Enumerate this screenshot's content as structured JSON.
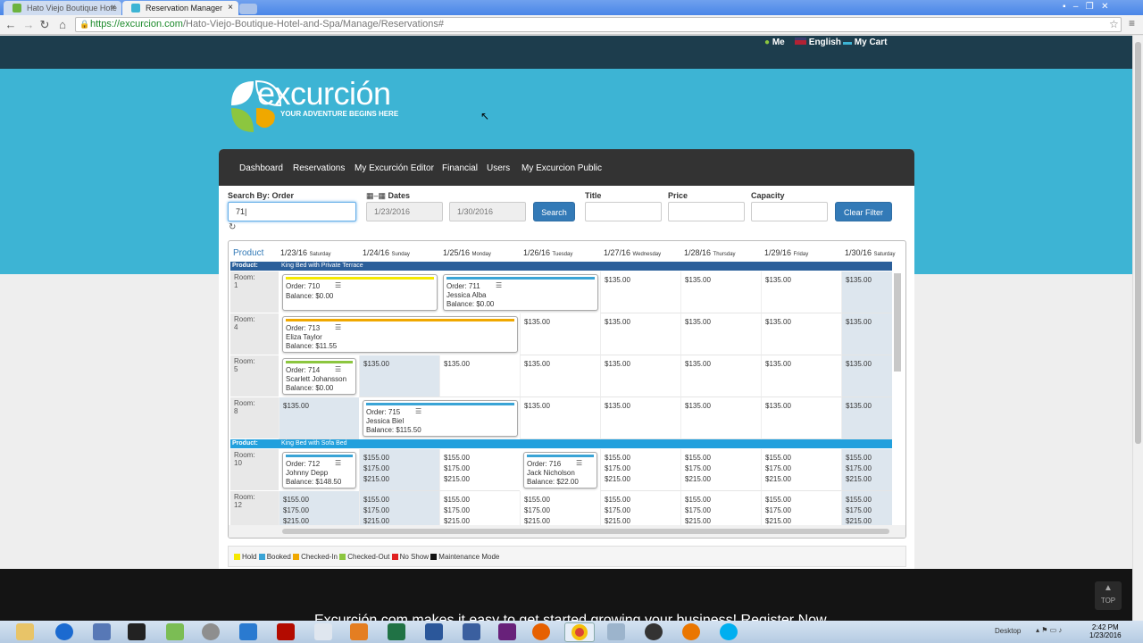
{
  "browser": {
    "tabs": [
      {
        "label": "Hato Viejo Boutique Hote"
      },
      {
        "label": "Reservation Manager"
      }
    ],
    "url_host": "https://excurcion.com",
    "url_path": "/Hato-Viejo-Boutique-Hotel-and-Spa/Manage/Reservations#"
  },
  "topnav": {
    "me": "Me",
    "language": "English",
    "cart": "My Cart"
  },
  "logo": {
    "brand": "excurción",
    "tagline": "YOUR ADVENTURE BEGINS HERE"
  },
  "nav": [
    "Dashboard",
    "Reservations",
    "My Excurción Editor",
    "Financial",
    "Users",
    "My Excurcion Public"
  ],
  "filters": {
    "search_label": "Search By: Order",
    "search_value": "71|",
    "dates_label": "Dates",
    "date_from": "1/23/2016",
    "date_to": "1/30/2016",
    "search_btn": "Search",
    "title_label": "Title",
    "price_label": "Price",
    "capacity_label": "Capacity",
    "clear_btn": "Clear Filter"
  },
  "grid": {
    "product_header": "Product",
    "days": [
      {
        "date": "1/23/16",
        "dow": "Saturday"
      },
      {
        "date": "1/24/16",
        "dow": "Sunday"
      },
      {
        "date": "1/25/16",
        "dow": "Monday"
      },
      {
        "date": "1/26/16",
        "dow": "Tuesday"
      },
      {
        "date": "1/27/16",
        "dow": "Wednesday"
      },
      {
        "date": "1/28/16",
        "dow": "Thursday"
      },
      {
        "date": "1/29/16",
        "dow": "Friday"
      },
      {
        "date": "1/30/16",
        "dow": "Saturday"
      }
    ],
    "product_label": "Product:",
    "room_label": "Room:",
    "products": [
      {
        "name": "King Bed with Private Terrace",
        "color": "#2b5f9a"
      },
      {
        "name": "King Bed with Sofa Bed",
        "color": "#22a0dd"
      }
    ],
    "rooms": [
      "1",
      "4",
      "5",
      "8",
      "10",
      "12"
    ],
    "price_a": "$135.00",
    "prices_b": [
      "$155.00",
      "$175.00",
      "$215.00"
    ],
    "orders": [
      {
        "order": "Order: 710",
        "guest": "",
        "balance": "Balance: $0.00",
        "color": "#f5e800"
      },
      {
        "order": "Order: 711",
        "guest": "Jessica Alba",
        "balance": "Balance: $0.00",
        "color": "#3aa4d6"
      },
      {
        "order": "Order: 713",
        "guest": "Eliza Taylor",
        "balance": "Balance: $11.55",
        "color": "#f0a800"
      },
      {
        "order": "Order: 714",
        "guest": "Scarlett Johansson",
        "balance": "Balance: $0.00",
        "color": "#8cc63f"
      },
      {
        "order": "Order: 715",
        "guest": "Jessica Biel",
        "balance": "Balance: $115.50",
        "color": "#3aa4d6"
      },
      {
        "order": "Order: 712",
        "guest": "Johnny Depp",
        "balance": "Balance: $148.50",
        "color": "#3aa4d6"
      },
      {
        "order": "Order: 716",
        "guest": "Jack Nicholson",
        "balance": "Balance: $22.00",
        "color": "#3aa4d6"
      }
    ]
  },
  "legend": [
    {
      "label": "Hold",
      "color": "#f5e800"
    },
    {
      "label": "Booked",
      "color": "#3aa4d6"
    },
    {
      "label": "Checked-In",
      "color": "#f0a800"
    },
    {
      "label": "Checked-Out",
      "color": "#8cc63f"
    },
    {
      "label": "No Show",
      "color": "#e02020"
    },
    {
      "label": "Maintenance Mode",
      "color": "#111111"
    }
  ],
  "footer": {
    "text": "Excurción.com makes it easy to get started growing your business! Register Now"
  },
  "top_button": "TOP",
  "taskbar": {
    "desktop": "Desktop",
    "time": "2:42 PM",
    "date": "1/23/2016"
  }
}
